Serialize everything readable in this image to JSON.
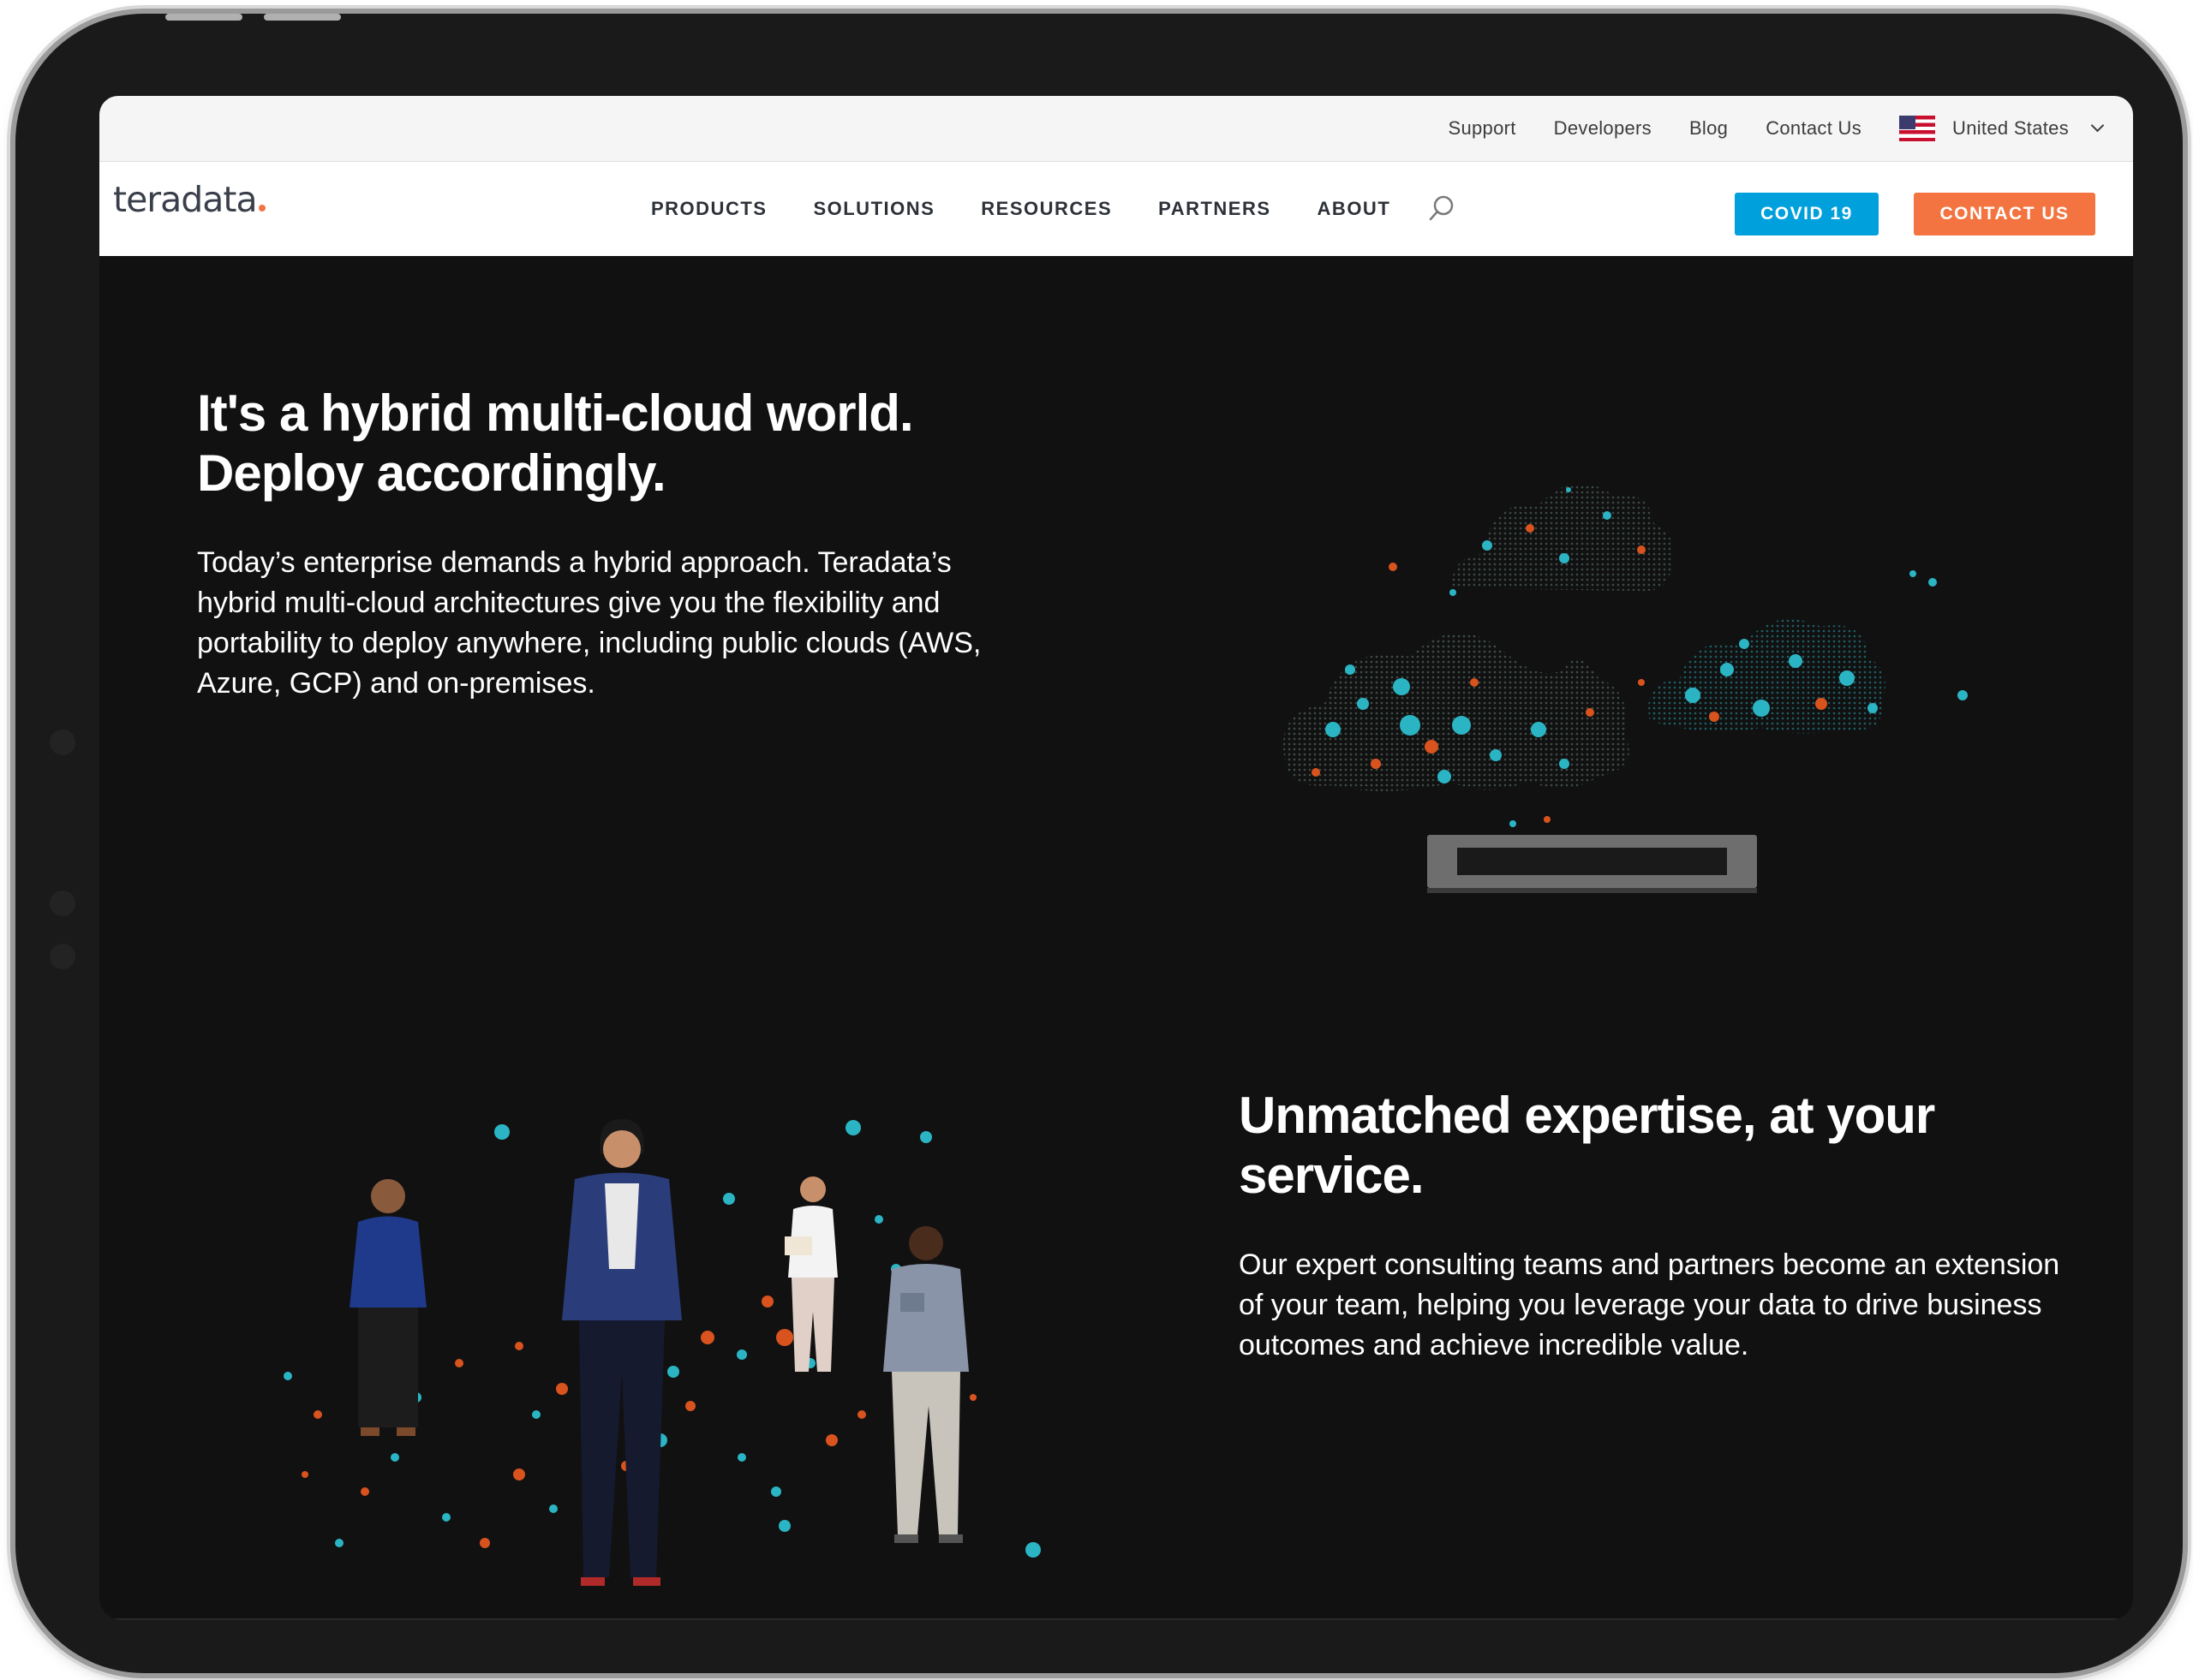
{
  "utility_nav": {
    "support": "Support",
    "developers": "Developers",
    "blog": "Blog",
    "contact": "Contact Us",
    "region": "United States"
  },
  "brand": {
    "logo_text": "teradata",
    "accent_color": "#f37440"
  },
  "main_nav": {
    "items": [
      "PRODUCTS",
      "SOLUTIONS",
      "RESOURCES",
      "PARTNERS",
      "ABOUT"
    ],
    "covid_button": "COVID 19",
    "contact_button": "CONTACT US"
  },
  "colors": {
    "covid_blue": "#00a0dc",
    "contact_orange": "#f37440",
    "background": "#111111",
    "particle_teal": "#2bb5c4",
    "particle_orange": "#d9531e"
  },
  "hero": {
    "heading_line1": "It's a hybrid multi-cloud world.",
    "heading_line2": "Deploy accordingly.",
    "body": "Today’s enterprise demands a hybrid approach. Teradata’s hybrid multi-cloud architectures give you the flexibility and portability to deploy anywhere, including public clouds (AWS, Azure, GCP) and on-premises."
  },
  "expertise": {
    "heading_line1": "Unmatched expertise, at your",
    "heading_line2": "service.",
    "body": "Our expert consulting teams and partners become an extension of your team, helping you leverage your data to drive business outcomes and achieve incredible value."
  },
  "icons": {
    "search": "search-icon",
    "region_flag": "us-flag-icon",
    "dropdown": "chevron-down-icon"
  }
}
